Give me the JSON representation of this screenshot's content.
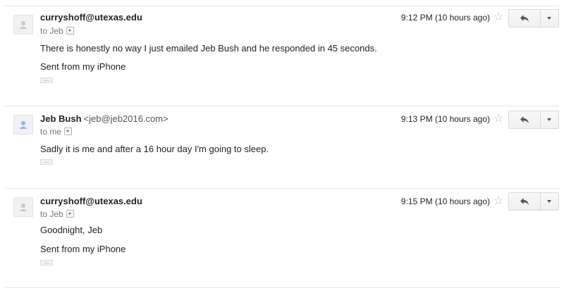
{
  "messages": [
    {
      "sender_name": "curryshoff@utexas.edu",
      "sender_email": "",
      "recipient": "to Jeb",
      "timestamp": "9:12 PM (10 hours ago)",
      "body": [
        "There is honestly no way I just emailed Jeb Bush and he responded in 45 seconds.",
        "Sent from my iPhone"
      ],
      "ellipsis": "...",
      "star_icon": "star-outline-icon",
      "reply_icon": "reply-arrow-icon",
      "more_icon": "chevron-down-icon"
    },
    {
      "sender_name": "Jeb Bush",
      "sender_email": "<jeb@jeb2016.com>",
      "recipient": "to me",
      "timestamp": "9:13 PM (10 hours ago)",
      "body": [
        "Sadly it is me and after a 16 hour day I'm going to sleep."
      ],
      "ellipsis": "...",
      "star_icon": "star-outline-icon",
      "reply_icon": "reply-arrow-icon",
      "more_icon": "chevron-down-icon"
    },
    {
      "sender_name": "curryshoff@utexas.edu",
      "sender_email": "",
      "recipient": "to Jeb",
      "timestamp": "9:15 PM (10 hours ago)",
      "body": [
        "Goodnight, Jeb",
        "Sent from my iPhone"
      ],
      "ellipsis": "...",
      "star_icon": "star-outline-icon",
      "reply_icon": "reply-arrow-icon",
      "more_icon": "chevron-down-icon"
    }
  ],
  "colors": {
    "divider": "#e5e5e5",
    "star": "#bdbdbd",
    "meta_text": "#777777",
    "body_text": "#222222"
  }
}
